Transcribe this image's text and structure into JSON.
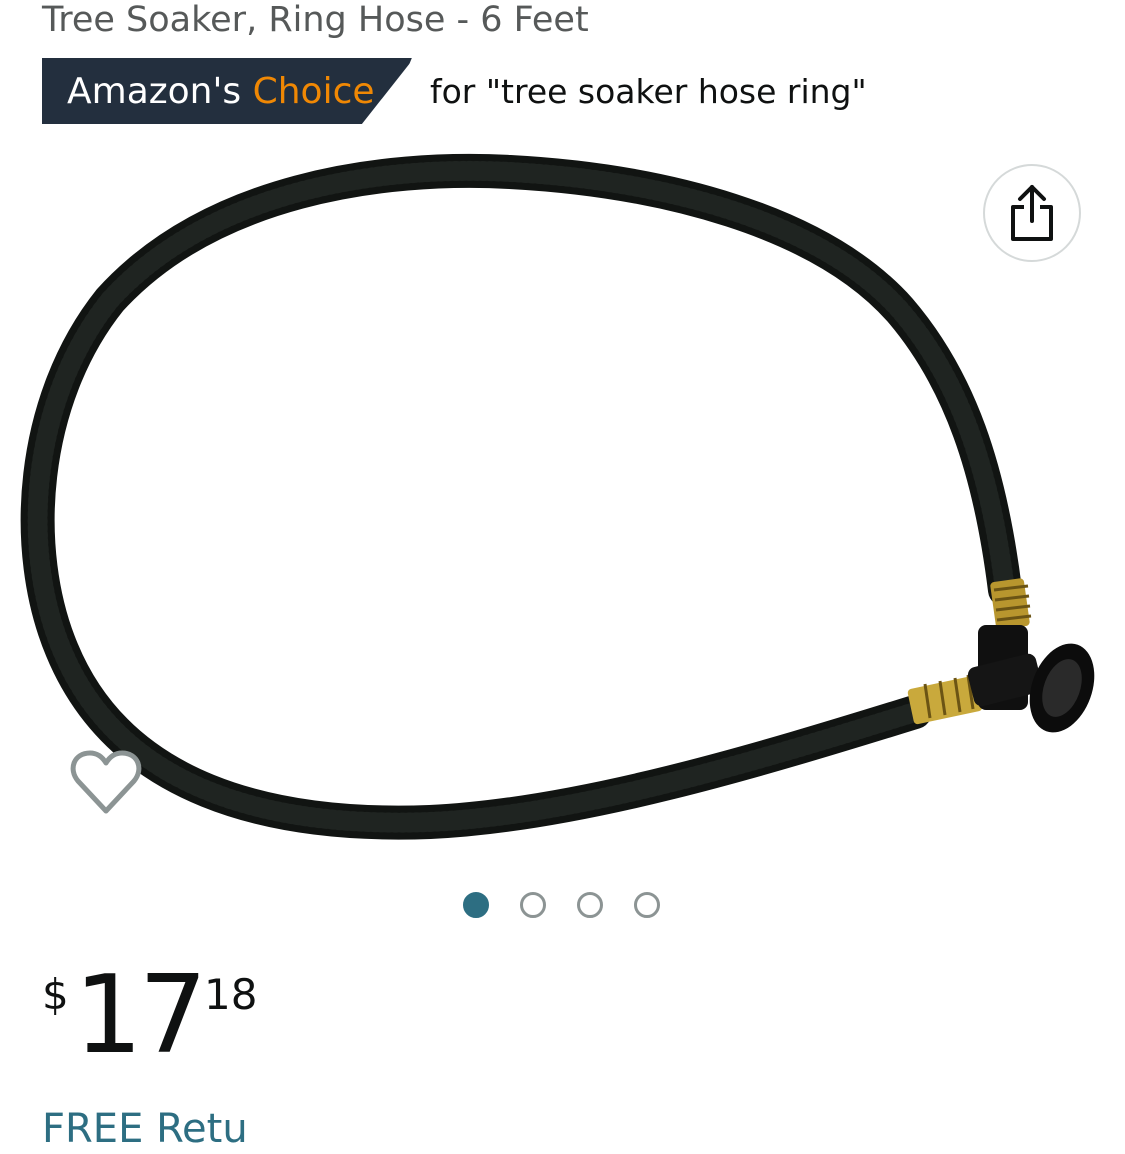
{
  "product": {
    "title": "Tree Soaker, Ring Hose - 6 Feet"
  },
  "badge": {
    "prefix": "Amazon's ",
    "highlight": "Choice",
    "query": "for \"tree soaker hose ring\"",
    "bg_color": "#232f3e",
    "accent_color": "#f08804"
  },
  "image_actions": {
    "share_icon": "share-icon",
    "wishlist_icon": "heart-outline-icon"
  },
  "carousel": {
    "total": 4,
    "active_index": 0,
    "active_color": "#2d6e82"
  },
  "price": {
    "symbol": "$",
    "whole": "17",
    "fraction": "18"
  },
  "delivery": {
    "text": "FREE Retu"
  }
}
